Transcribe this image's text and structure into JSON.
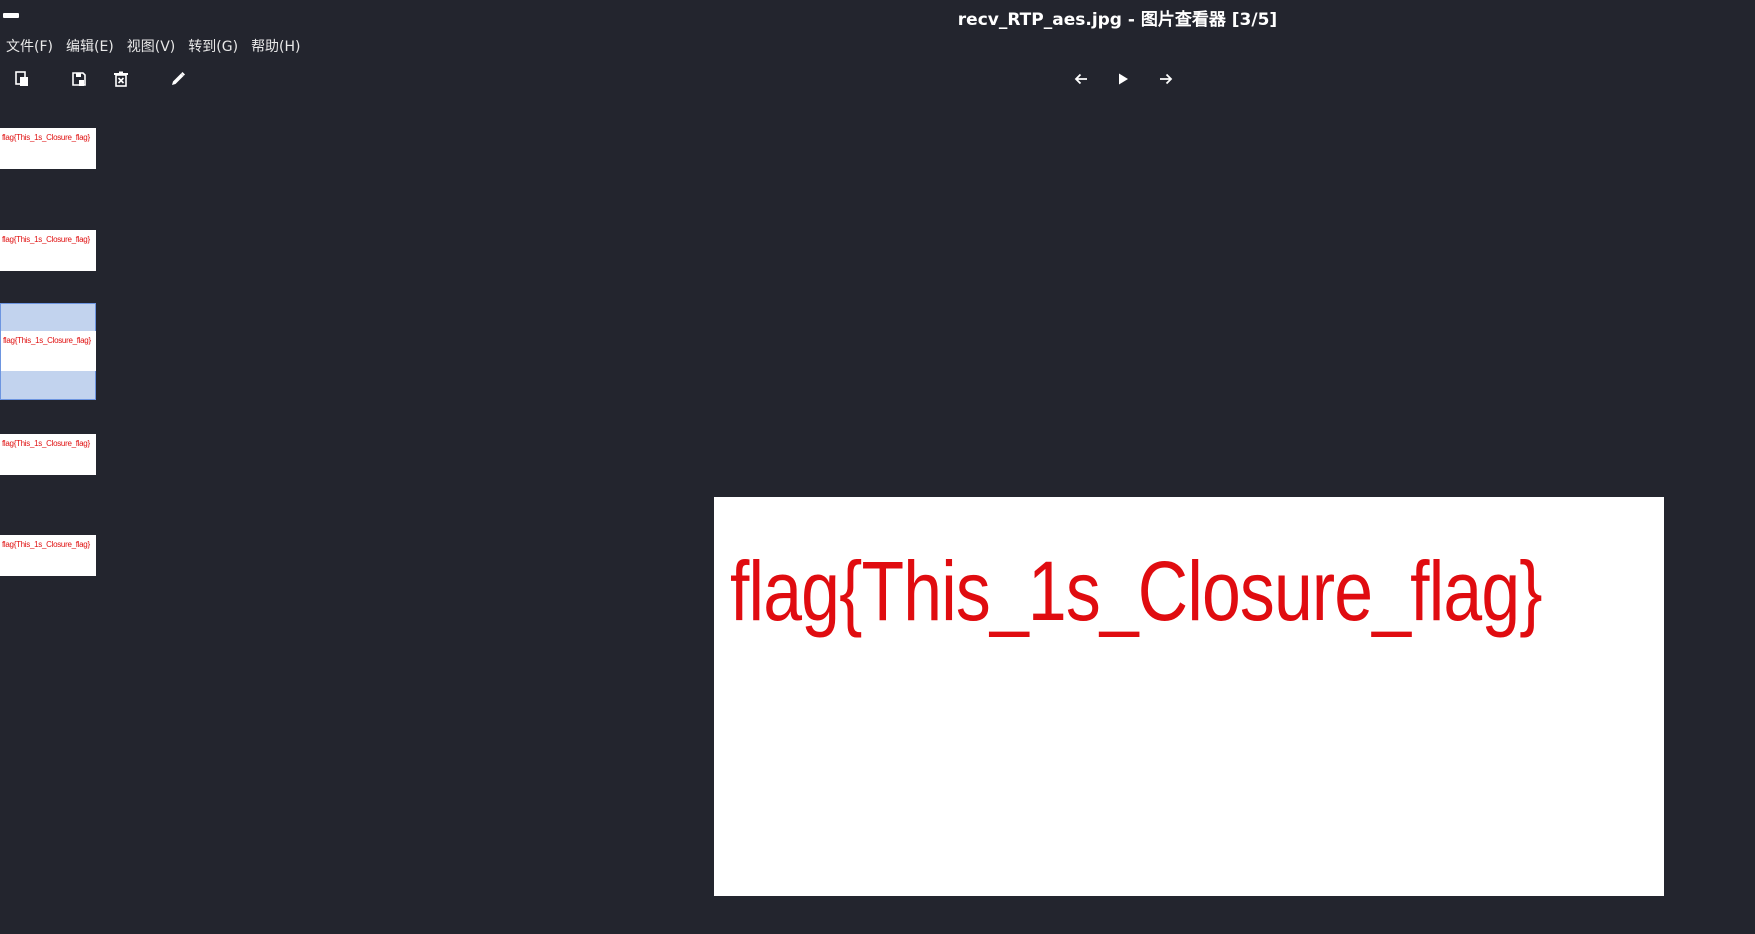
{
  "window": {
    "title": "recv_RTP_aes.jpg - 图片查看器 [3/5]"
  },
  "menubar": {
    "items": [
      {
        "label": "文件(F)"
      },
      {
        "label": "编辑(E)"
      },
      {
        "label": "视图(V)"
      },
      {
        "label": "转到(G)"
      },
      {
        "label": "帮助(H)"
      }
    ]
  },
  "toolbar": {
    "left_icons": [
      "open-icon",
      "save-icon",
      "delete-icon",
      "edit-icon"
    ],
    "nav_icons": [
      "previous-icon",
      "play-icon",
      "next-icon"
    ]
  },
  "thumbnails": {
    "selected_index": 3,
    "items": [
      {
        "text": "flag{This_1s_Closure_flag}"
      },
      {
        "text": "flag{This_1s_Closure_flag}"
      },
      {
        "text": "flag{This_1s_Closure_flag}"
      },
      {
        "text": "flag{This_1s_Closure_flag}"
      },
      {
        "text": "flag{This_1s_Closure_flag}"
      }
    ]
  },
  "main_image": {
    "text": "flag{This_1s_Closure_flag}"
  },
  "colors": {
    "background": "#23252e",
    "flag_text": "#e00c10",
    "selection": "#c2d3ee",
    "selection_border": "#6d95e0"
  }
}
